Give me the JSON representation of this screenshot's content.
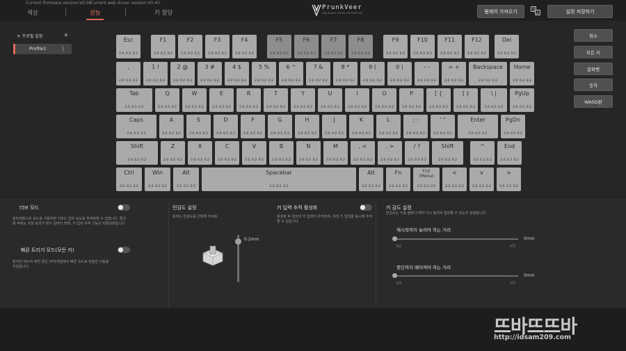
{
  "header": {
    "firmware_version": "Current firmware version:V0.08",
    "driver_version": "Current web driver version:V0.40",
    "tabs": [
      {
        "label": "색상",
        "active": false
      },
      {
        "label": "성능",
        "active": true
      },
      {
        "label": "키 할당",
        "active": false
      }
    ],
    "logo_text": "PrunkVeer",
    "logo_sub": "UNLEASH YOUR POTENTIAL",
    "import_button": "펌웨어 가져오기",
    "save_button": "설정 저장하기",
    "language_icon": "translate-icon",
    "accent_color": "#e06a5c"
  },
  "profile": {
    "header_label": "프로필 설정",
    "add_icon": "plus-icon",
    "items": [
      {
        "label": "Profile1",
        "active": true
      }
    ]
  },
  "keyboard": {
    "key_values": "2.0  0.2  0.2",
    "rows": [
      [
        {
          "label": "Esc",
          "w": 35
        },
        {
          "gap": 11
        },
        {
          "label": "F1",
          "w": 35
        },
        {
          "label": "F2",
          "w": 35
        },
        {
          "label": "F3",
          "w": 35
        },
        {
          "label": "F4",
          "w": 35
        },
        {
          "gap": 11
        },
        {
          "label": "F5",
          "w": 35,
          "dark": true
        },
        {
          "label": "F6",
          "w": 35,
          "dark": true
        },
        {
          "label": "F7",
          "w": 35,
          "dark": true
        },
        {
          "label": "F8",
          "w": 35,
          "dark": true
        },
        {
          "gap": 11
        },
        {
          "label": "F9",
          "w": 35
        },
        {
          "label": "F10",
          "w": 35
        },
        {
          "label": "F11",
          "w": 35
        },
        {
          "label": "F12",
          "w": 35
        },
        {
          "gap": 4
        },
        {
          "label": "Del",
          "w": 35
        }
      ],
      [
        {
          "label": ",",
          "w": 35
        },
        {
          "label": "1 !",
          "w": 35
        },
        {
          "label": "2 @",
          "w": 35
        },
        {
          "label": "3 #",
          "w": 35
        },
        {
          "label": "4 $",
          "w": 35
        },
        {
          "label": "5 %",
          "w": 35
        },
        {
          "label": "6 ^",
          "w": 35
        },
        {
          "label": "7 &",
          "w": 35
        },
        {
          "label": "8 *",
          "w": 35
        },
        {
          "label": "9 (",
          "w": 35
        },
        {
          "label": "0 )",
          "w": 35
        },
        {
          "label": "- -",
          "w": 35
        },
        {
          "label": "= +",
          "w": 35
        },
        {
          "label": "Backspace",
          "w": 55
        },
        {
          "label": "Home",
          "w": 35
        }
      ],
      [
        {
          "label": "Tab",
          "w": 52
        },
        {
          "label": "Q",
          "w": 35
        },
        {
          "label": "W",
          "w": 35
        },
        {
          "label": "E",
          "w": 35
        },
        {
          "label": "R",
          "w": 35
        },
        {
          "label": "T",
          "w": 35
        },
        {
          "label": "Y",
          "w": 35
        },
        {
          "label": "U",
          "w": 35
        },
        {
          "label": "I",
          "w": 35
        },
        {
          "label": "O",
          "w": 35
        },
        {
          "label": "P",
          "w": 35
        },
        {
          "label": "[ {",
          "w": 35
        },
        {
          "label": "] }",
          "w": 35
        },
        {
          "label": "\\ |",
          "w": 38
        },
        {
          "label": "PgUp",
          "w": 35
        }
      ],
      [
        {
          "label": "Caps",
          "w": 58
        },
        {
          "label": "A",
          "w": 35
        },
        {
          "label": "S",
          "w": 35
        },
        {
          "label": "D",
          "w": 35
        },
        {
          "label": "F",
          "w": 35
        },
        {
          "label": "G",
          "w": 35
        },
        {
          "label": "H",
          "w": 35
        },
        {
          "label": "J",
          "w": 35
        },
        {
          "label": "K",
          "w": 35
        },
        {
          "label": "L",
          "w": 35
        },
        {
          "label": "; :",
          "w": 35
        },
        {
          "label": "' \"",
          "w": 35
        },
        {
          "label": "Enter",
          "w": 58
        },
        {
          "label": "PgDn",
          "w": 35
        }
      ],
      [
        {
          "label": "Shift",
          "w": 60
        },
        {
          "label": "Z",
          "w": 35
        },
        {
          "label": "X",
          "w": 35
        },
        {
          "label": "C",
          "w": 35
        },
        {
          "label": "V",
          "w": 35
        },
        {
          "label": "B",
          "w": 35
        },
        {
          "label": "N",
          "w": 35
        },
        {
          "label": "M",
          "w": 35
        },
        {
          "label": ", <",
          "w": 35
        },
        {
          "label": ". >",
          "w": 35
        },
        {
          "label": "/ ?",
          "w": 35
        },
        {
          "label": "Shift",
          "w": 45
        },
        {
          "gap": 6
        },
        {
          "label": "^",
          "w": 35
        },
        {
          "label": "End",
          "w": 35
        }
      ],
      [
        {
          "label": "Ctrl",
          "w": 37
        },
        {
          "label": "Win",
          "w": 37
        },
        {
          "label": "Alt",
          "w": 37
        },
        {
          "label": "Spacebar",
          "w": 222
        },
        {
          "label": "Alt",
          "w": 35
        },
        {
          "label": "Fn",
          "w": 35
        },
        {
          "label": "Fn2\n(Menu)",
          "w": 38,
          "small": true
        },
        {
          "label": "<",
          "w": 35
        },
        {
          "label": "v",
          "w": 35
        },
        {
          "label": ">",
          "w": 35
        }
      ]
    ]
  },
  "right_buttons": [
    "취소",
    "모든 키",
    "알파벳",
    "숫자",
    "WASD판"
  ],
  "turbo": {
    "title": "터보 모드",
    "desc": "슬트래레스트 모드를 사용하면 키보드 입력 속도를 최적화할 수 있습니다. 활성화 후에는 초망 효과가 정지 상태가 되며, 키 입력 추적 기능이 비활성화됩니다",
    "enabled": false
  },
  "rapid_trigger": {
    "title": "빠른 트리거 모드(모든 키)",
    "desc": "놓이면 재시작 제연 중단 /FPS게임에서 빠른 속도로 정밀한 이동을 지원합니다.",
    "enabled": false
  },
  "sensitivity": {
    "title": "민감도 설정",
    "desc": "원하는 민감도를 선택해 주세요",
    "value": "0.2mm",
    "level": 0.05
  },
  "key_tracking": {
    "title": "키 입력 추적 활성화",
    "desc": "활성화 후 임의의 키 입력이 추적되며, 여러 키 입력을 동시에 추적할 수 있습니다",
    "enabled": false
  },
  "key_sensitivity": {
    "title": "키 감도 설정",
    "desc": "민감도는 키를 될마나 떼야 다시 눌러서 입력할 수 있는지 설정합니다",
    "press": {
      "label": "재시작까지 눌러야 하는 거리",
      "value": "0mm",
      "min_label": "높음",
      "max_label": "낮음",
      "level": 0
    },
    "release": {
      "label": "중단까지 떼어져야 하는 거리",
      "value": "0mm",
      "min_label": "높음",
      "max_label": "낮음",
      "level": 0
    }
  },
  "watermark": {
    "title": "뜨바뜨뜨바",
    "url": "http://idsam209.com"
  }
}
